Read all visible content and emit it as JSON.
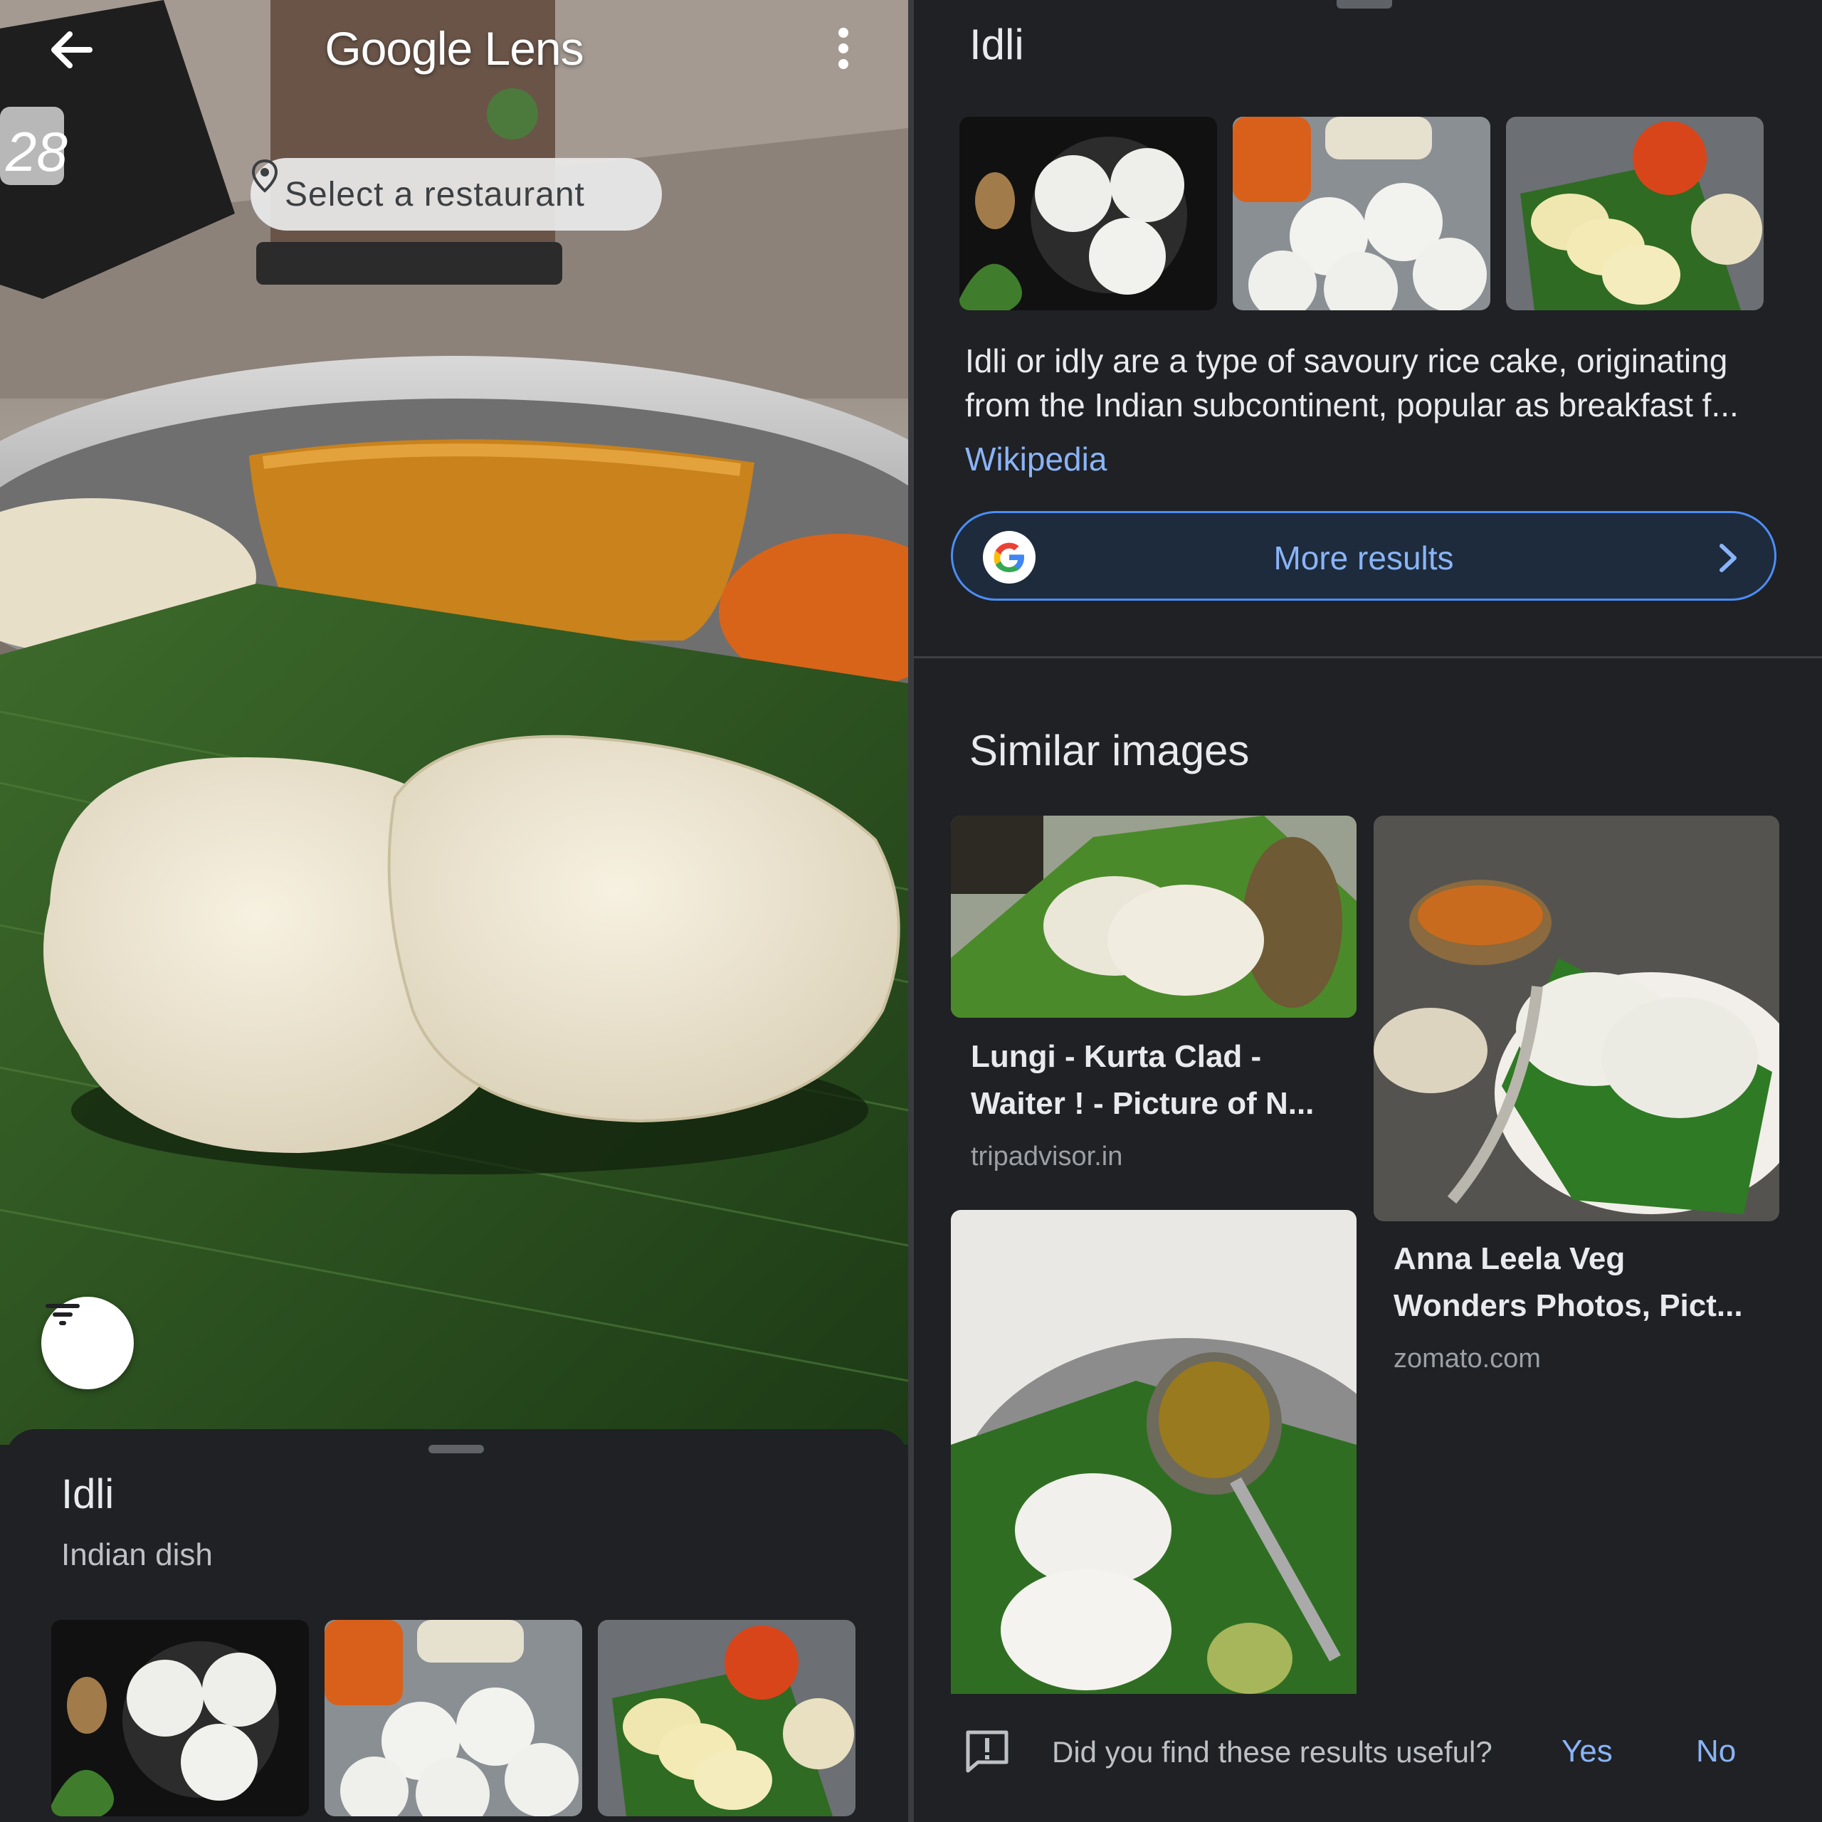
{
  "header": {
    "app_title": "Google Lens",
    "back_icon": "arrow-back-icon",
    "menu_icon": "more-vert-icon"
  },
  "camera": {
    "restaurant_chip_label": "Select a restaurant",
    "location_icon": "location-pin-icon",
    "filter_icon": "filter-list-icon",
    "overlay_number": "28"
  },
  "sheet": {
    "title": "Idli",
    "subtitle": "Indian dish",
    "thumbnails": [
      "idli-on-black-plate",
      "idli-steel-plate-with-sambar",
      "idli-banana-leaf-with-chutneys"
    ]
  },
  "result": {
    "title": "Idli",
    "description_line1": "Idli or idly are a type of savoury rice cake, originating",
    "description_line2": "from the Indian subcontinent, popular as breakfast f...",
    "source": "Wikipedia",
    "more_results_label": "More results",
    "google_icon": "google-g-icon",
    "chevron_icon": "chevron-right-icon"
  },
  "similar": {
    "title": "Similar images",
    "cards": [
      {
        "title_line1": "Lungi - Kurta Clad -",
        "title_line2": "Waiter ! - Picture of N...",
        "source": "tripadvisor.in"
      },
      {
        "title_line1": "Anna Leela Veg",
        "title_line2": "Wonders Photos, Pict...",
        "source": "zomato.com"
      }
    ]
  },
  "feedback": {
    "question": "Did you find these results useful?",
    "yes": "Yes",
    "no": "No",
    "icon": "feedback-icon"
  },
  "colors": {
    "background": "#1f2124",
    "accent_blue": "#8ab4f8",
    "button_border": "#4c8df6",
    "leaf_green": "#2e5a22",
    "idli_white": "#f1ead8"
  }
}
